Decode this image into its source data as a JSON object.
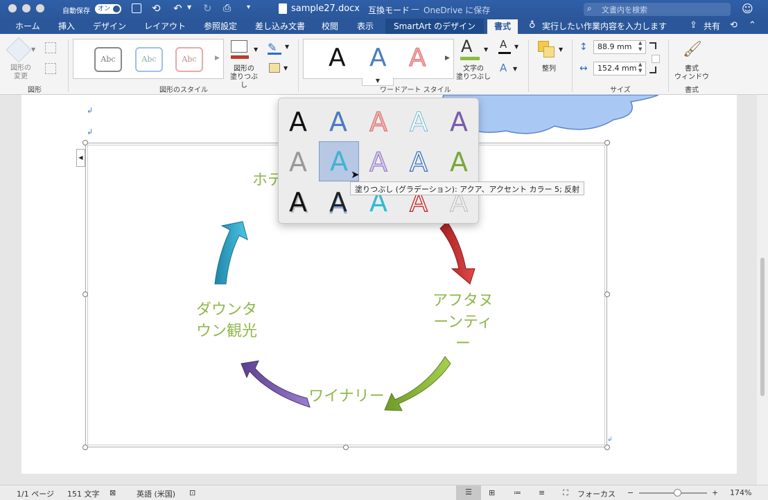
{
  "titlebar": {
    "autosave_label": "自動保存",
    "autosave_toggle": "オン",
    "filename": "sample27.docx",
    "separator": "—",
    "mode": "互換モード",
    "save_location": "OneDrive に保存",
    "search_placeholder": "文書内を検索"
  },
  "tabs": [
    {
      "label": "ホーム"
    },
    {
      "label": "挿入"
    },
    {
      "label": "デザイン"
    },
    {
      "label": "レイアウト"
    },
    {
      "label": "参照設定"
    },
    {
      "label": "差し込み文書"
    },
    {
      "label": "校閲"
    },
    {
      "label": "表示"
    },
    {
      "label": "SmartArt のデザイン"
    },
    {
      "label": "書式"
    }
  ],
  "tell_me": "実行したい作業内容を入力します",
  "share_label": "共有",
  "ribbon": {
    "shapes_group": {
      "change_shape": "図形の\n変更",
      "group_label": "図形"
    },
    "shape_styles_group": {
      "sample_text": "Abc",
      "fill_label": "図形の\n塗りつぶし",
      "group_label": "図形のスタイル"
    },
    "wordart_group": {
      "letter": "A",
      "text_fill_label": "文字の\n塗りつぶし",
      "group_label": "ワードアート スタイル"
    },
    "arrange_group": {
      "label": "整列"
    },
    "size_group": {
      "height_value": "88.9 mm",
      "width_value": "152.4 mm",
      "group_label": "サイズ"
    },
    "format_group": {
      "pane_label": "書式\nウィンドウ",
      "group_label": "書式"
    }
  },
  "colors": {
    "accent_blue": "#2b579a",
    "smartart_text": "#8fb84a",
    "arrow_red": "#c63232",
    "arrow_green": "#8cbc3c",
    "arrow_purple": "#7a5cab",
    "arrow_teal": "#2fa6c4"
  },
  "gallery": {
    "letter": "A",
    "tooltip": "塗りつぶし (グラデーション): アクア、アクセント カラー 5; 反射"
  },
  "smartart": {
    "nodes": [
      "ホテ",
      "アフタヌーンティー",
      "ワイナリー",
      "ダウンタウン観光"
    ]
  },
  "statusbar": {
    "page": "1/1 ページ",
    "words": "151 文字",
    "language": "英語 (米国)",
    "focus": "フォーカス",
    "zoom": "174%"
  }
}
